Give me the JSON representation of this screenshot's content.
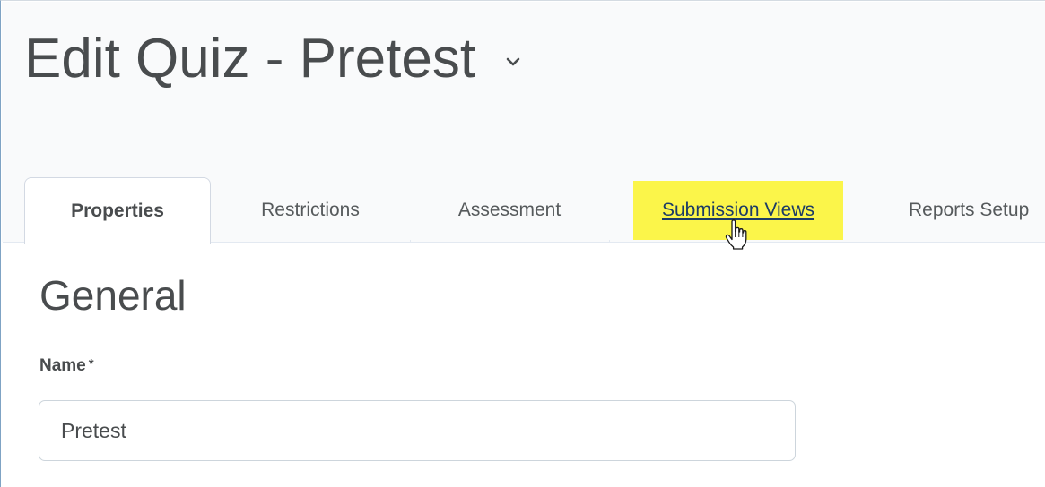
{
  "header": {
    "title": "Edit Quiz - Pretest",
    "title_menu_icon": "chevron-down-icon"
  },
  "tabs": [
    {
      "label": "Properties",
      "state": "active"
    },
    {
      "label": "Restrictions",
      "state": "normal"
    },
    {
      "label": "Assessment",
      "state": "normal"
    },
    {
      "label": "Submission Views",
      "state": "hovered-highlighted"
    },
    {
      "label": "Reports Setup",
      "state": "normal"
    }
  ],
  "cursor": {
    "icon": "hand-pointer-icon"
  },
  "content": {
    "section_title": "General",
    "name_field": {
      "label": "Name",
      "required_mark": "*",
      "value": "Pretest"
    }
  },
  "colors": {
    "highlight": "#fbf54a",
    "link_text": "#1c3b66",
    "text": "#494c4e",
    "header_bg": "#f9fafb"
  }
}
